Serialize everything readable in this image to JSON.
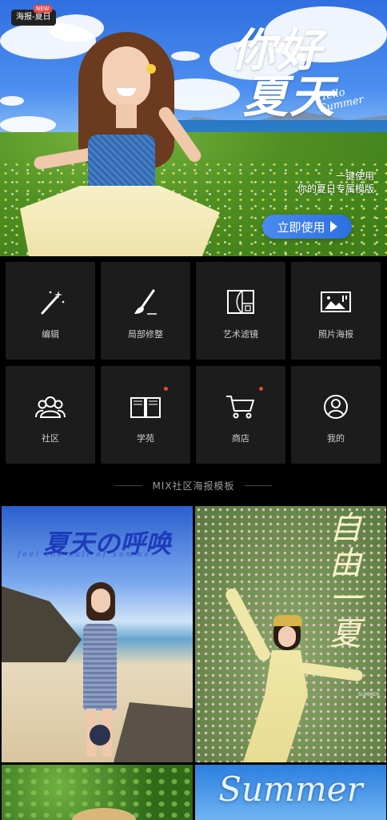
{
  "banner": {
    "badge": "海报-夏日",
    "badge_new": "NEW",
    "title_line1": "你好",
    "title_line2": "夏天",
    "title_en_line1": "Hello",
    "title_en_line2": "Summer",
    "promo_line1": "一键使用",
    "promo_line2": "你的夏日专属模版",
    "cta_label": "立即使用"
  },
  "tools": [
    {
      "label": "编辑",
      "icon": "magic-wand-icon",
      "has_dot": false
    },
    {
      "label": "局部修整",
      "icon": "brush-icon",
      "has_dot": false
    },
    {
      "label": "艺术滤镜",
      "icon": "golden-ratio-frame-icon",
      "has_dot": false
    },
    {
      "label": "照片海报",
      "icon": "photo-poster-icon",
      "has_dot": false
    },
    {
      "label": "社区",
      "icon": "community-icon",
      "has_dot": false
    },
    {
      "label": "学苑",
      "icon": "book-icon",
      "has_dot": true
    },
    {
      "label": "商店",
      "icon": "cart-icon",
      "has_dot": true
    },
    {
      "label": "我的",
      "icon": "profile-icon",
      "has_dot": false
    }
  ],
  "section": {
    "title": "MIX社区海报模板"
  },
  "posters": {
    "p1_title": "夏天の呼唤",
    "p1_sub": "feel the call of summer",
    "p2_title": "自由一夏",
    "p2_small": "SUMMER",
    "p4_title": "Summer"
  },
  "colors": {
    "accent_blue": "#2c6fe0",
    "notification_dot": "#e8453c",
    "tile_bg": "#1c1c1c"
  }
}
